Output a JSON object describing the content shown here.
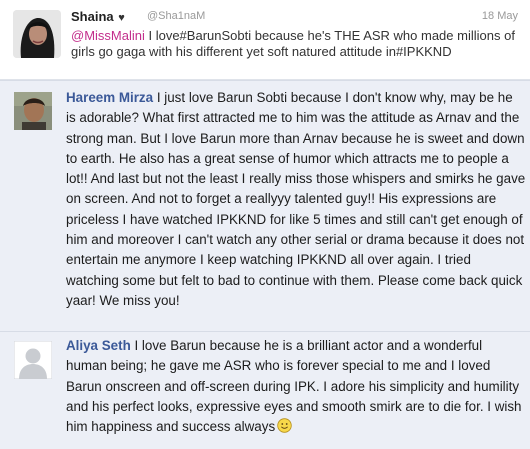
{
  "tweet": {
    "name": "Shaina",
    "heart": "♥",
    "handle": "@Sha1naM",
    "date": "18 May",
    "mention": "@MissMalini",
    "text": " I love#BarunSobti because he's THE ASR who made millions of girls go gaga with his different yet soft natured attitude in#IPKKND",
    "avatar_icon": "user-photo-icon"
  },
  "comments": [
    {
      "author": "Hareem Mirza",
      "text": " I just love Barun Sobti because I don't know why, may be he is adorable? What first attracted me to him was the attitude as Arnav and the strong man. But I love Barun more than Arnav because he is sweet and down to earth. He also has a great sense of humor which attracts me to people a lot!! And last but not the least I really miss those whispers and smirks he gave on screen. And not to forget a reallyyy talented guy!! His expressions are priceless I have watched IPKKND for like 5 times and still can't get enough of him and moreover I can't watch any other serial or drama because it does not entertain me anymore I keep watching IPKKND all over again. I tried watching some but felt to bad to continue with them. Please come back quick yaar! We miss you!",
      "avatar_icon": "user-photo-icon"
    },
    {
      "author": "Aliya Seth",
      "text": " I love Barun because he is a brilliant actor and a wonderful human being; he gave me ASR who is forever special to me and I loved Barun onscreen and off-screen during IPK. I adore his simplicity and humility and his perfect looks, expressive eyes and smooth smirk are to die for. I wish him happiness and success always",
      "avatar_icon": "default-user-silhouette-icon",
      "trailing_icon": "smiley-emoticon-icon"
    }
  ],
  "colors": {
    "mention": "#c32f8c",
    "author": "#3b5998",
    "comment_bg": "#eceff6"
  }
}
